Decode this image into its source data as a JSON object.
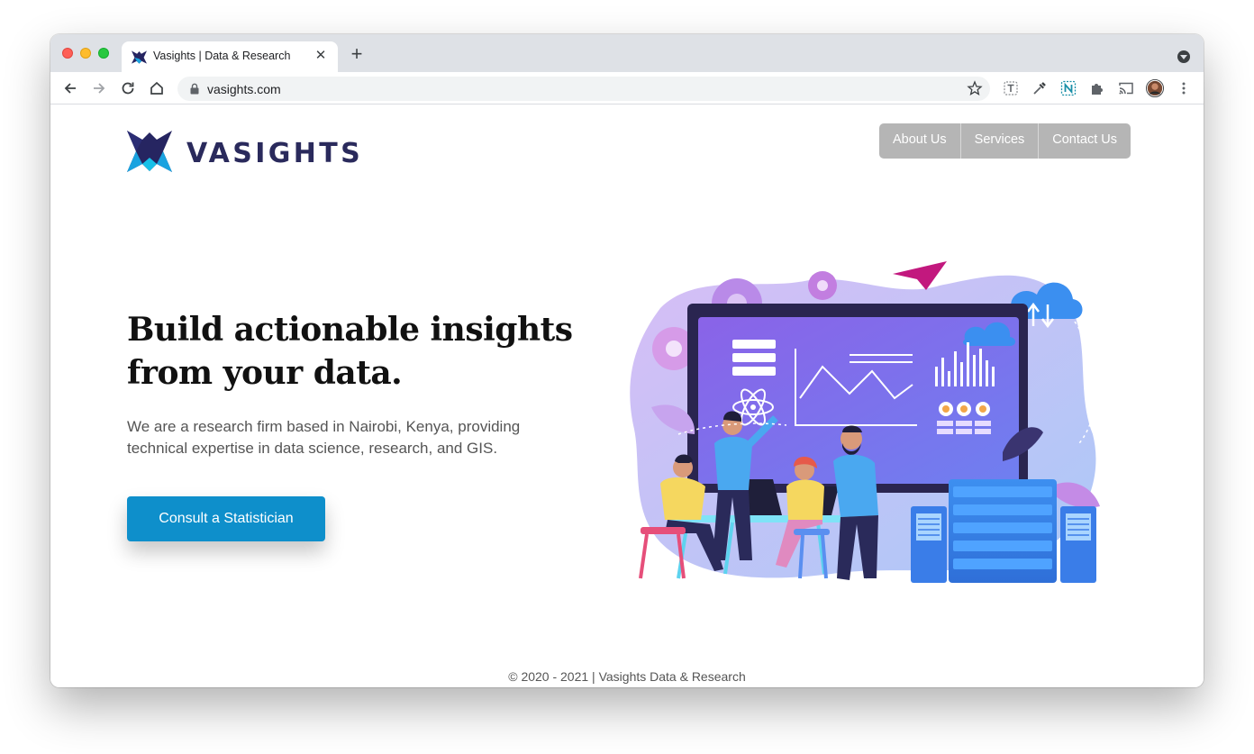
{
  "browser": {
    "tab": {
      "title": "Vasights | Data & Research",
      "close_glyph": "✕"
    },
    "new_tab_glyph": "+",
    "address": {
      "url": "vasights.com"
    },
    "icons": [
      "back-icon",
      "forward-icon",
      "reload-icon",
      "home-icon",
      "lock-icon",
      "star-icon",
      "text-extension-icon",
      "eyedropper-icon",
      "n-extension-icon",
      "puzzle-icon",
      "cast-icon",
      "profile-avatar",
      "kebab-menu-icon"
    ]
  },
  "site": {
    "brand": "VASIGHTS",
    "nav": [
      "About Us",
      "Services",
      "Contact Us"
    ],
    "hero": {
      "title_line1": "Build actionable insights",
      "title_line2": "from your data.",
      "subtitle": "We are a research firm based in Nairobi, Kenya, providing technical expertise in data science, research, and GIS.",
      "cta": "Consult a Statistician"
    },
    "footer": "© 2020 - 2021 | Vasights Data & Research"
  },
  "colors": {
    "accent": "#0e8fcb",
    "nav_bg": "#b5b5b5",
    "brand_text": "#2a2a5c",
    "logo_navy": "#262561",
    "logo_cyan": "#1aa3e0"
  }
}
